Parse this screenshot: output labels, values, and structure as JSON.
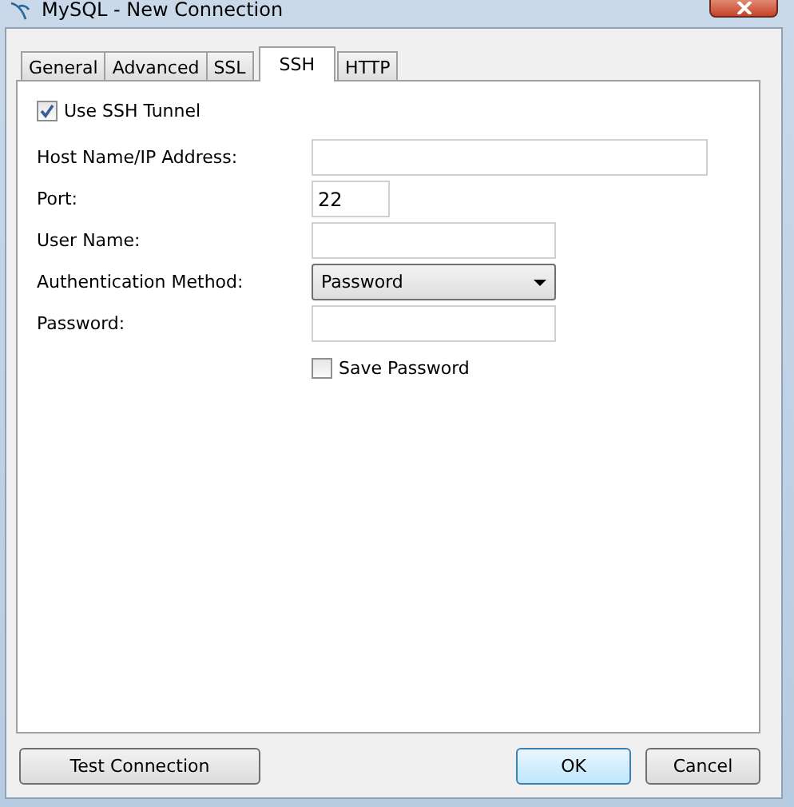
{
  "window": {
    "title": "MySQL - New Connection"
  },
  "tabs": [
    {
      "label": "General",
      "selected": false
    },
    {
      "label": "Advanced",
      "selected": false
    },
    {
      "label": "SSL",
      "selected": false
    },
    {
      "label": "SSH",
      "selected": true
    },
    {
      "label": "HTTP",
      "selected": false
    }
  ],
  "use_ssh_tunnel": {
    "label": "Use SSH Tunnel",
    "checked": true
  },
  "fields": [
    {
      "kind": "text",
      "label": "Host Name/IP Address:"
    },
    {
      "kind": "text",
      "label": "Port:",
      "value": "22"
    },
    {
      "kind": "text",
      "label": "User Name:"
    },
    {
      "kind": "select",
      "label": "Authentication Method:",
      "value": "Password"
    },
    {
      "kind": "password",
      "label": "Password:"
    }
  ],
  "save_password": {
    "label": "Save Password",
    "checked": false
  },
  "buttons": [
    {
      "label": "Test Connection",
      "kind": "secondary"
    },
    {
      "label": "OK",
      "kind": "default"
    },
    {
      "label": "Cancel",
      "kind": "secondary"
    }
  ]
}
